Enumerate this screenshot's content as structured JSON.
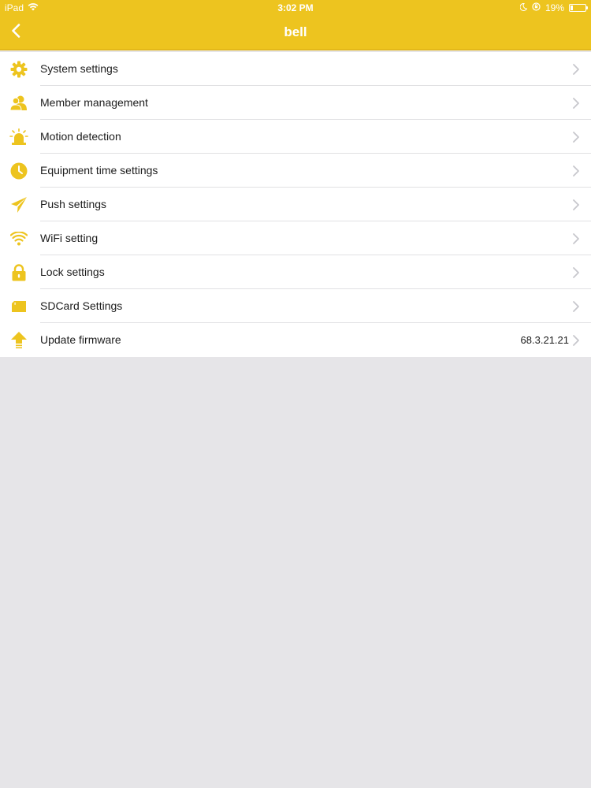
{
  "status_bar": {
    "device": "iPad",
    "time": "3:02 PM",
    "battery_percent": "19%",
    "battery_level": 0.19
  },
  "nav": {
    "title": "bell",
    "back_icon": "chevron-left-icon"
  },
  "colors": {
    "accent": "#edc41f",
    "background": "#e6e5e8",
    "row_background": "#ffffff",
    "chevron": "#c7c7cc"
  },
  "settings": {
    "items": [
      {
        "label": "System settings",
        "icon": "gear-icon"
      },
      {
        "label": "Member management",
        "icon": "members-icon"
      },
      {
        "label": "Motion detection",
        "icon": "alarm-icon"
      },
      {
        "label": "Equipment time settings",
        "icon": "clock-icon"
      },
      {
        "label": "Push settings",
        "icon": "paper-plane-icon"
      },
      {
        "label": "WiFi setting",
        "icon": "wifi-icon"
      },
      {
        "label": "Lock settings",
        "icon": "lock-icon"
      },
      {
        "label": "SDCard Settings",
        "icon": "sd-card-icon"
      },
      {
        "label": "Update firmware",
        "icon": "upload-arrow-icon",
        "value": "68.3.21.21"
      }
    ]
  }
}
